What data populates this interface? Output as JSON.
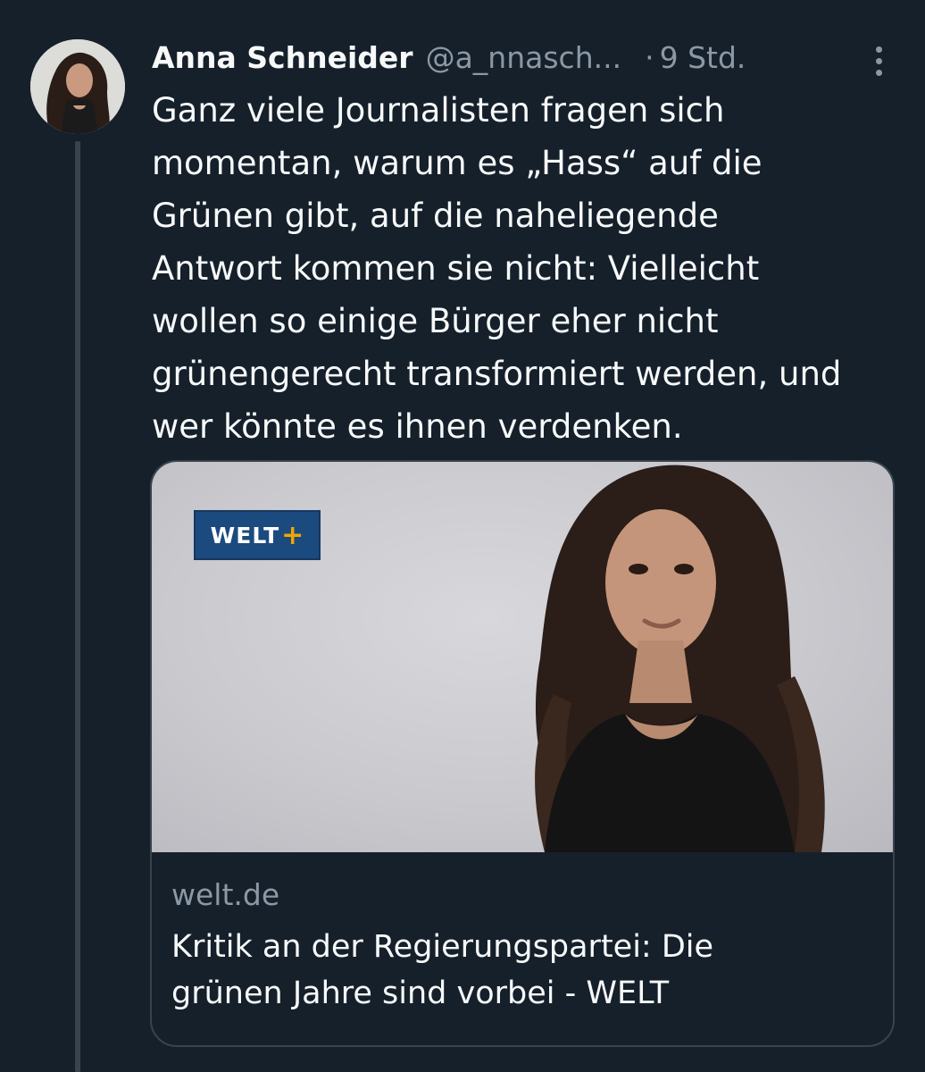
{
  "tweet": {
    "author_name": "Anna Schneider",
    "author_handle": "@a_nnasch...",
    "separator": "·",
    "time": "9 Std.",
    "text": "Ganz viele Journalisten fragen sich\nmomentan, warum es „Hass“ auf die\nGrünen gibt, auf die naheliegende\nAntwort kommen sie nicht: Vielleicht\nwollen so einige Bürger eher nicht\ngrünengerecht transformiert werden, und\nwer könnte es ihnen verdenken."
  },
  "card": {
    "logo_text": "WELT",
    "logo_plus": "+",
    "domain": "welt.de",
    "title": "Kritik an der Regierungspartei: Die\ngrünen Jahre sind vorbei - WELT"
  },
  "colors": {
    "background": "#15202b",
    "text_primary": "#f7f9f9",
    "text_secondary": "#8b98a5",
    "border": "#38444d",
    "welt_blue": "#1b4a7e",
    "welt_plus": "#f2a400"
  },
  "icons": {
    "more": "more-dots-vertical-icon"
  }
}
